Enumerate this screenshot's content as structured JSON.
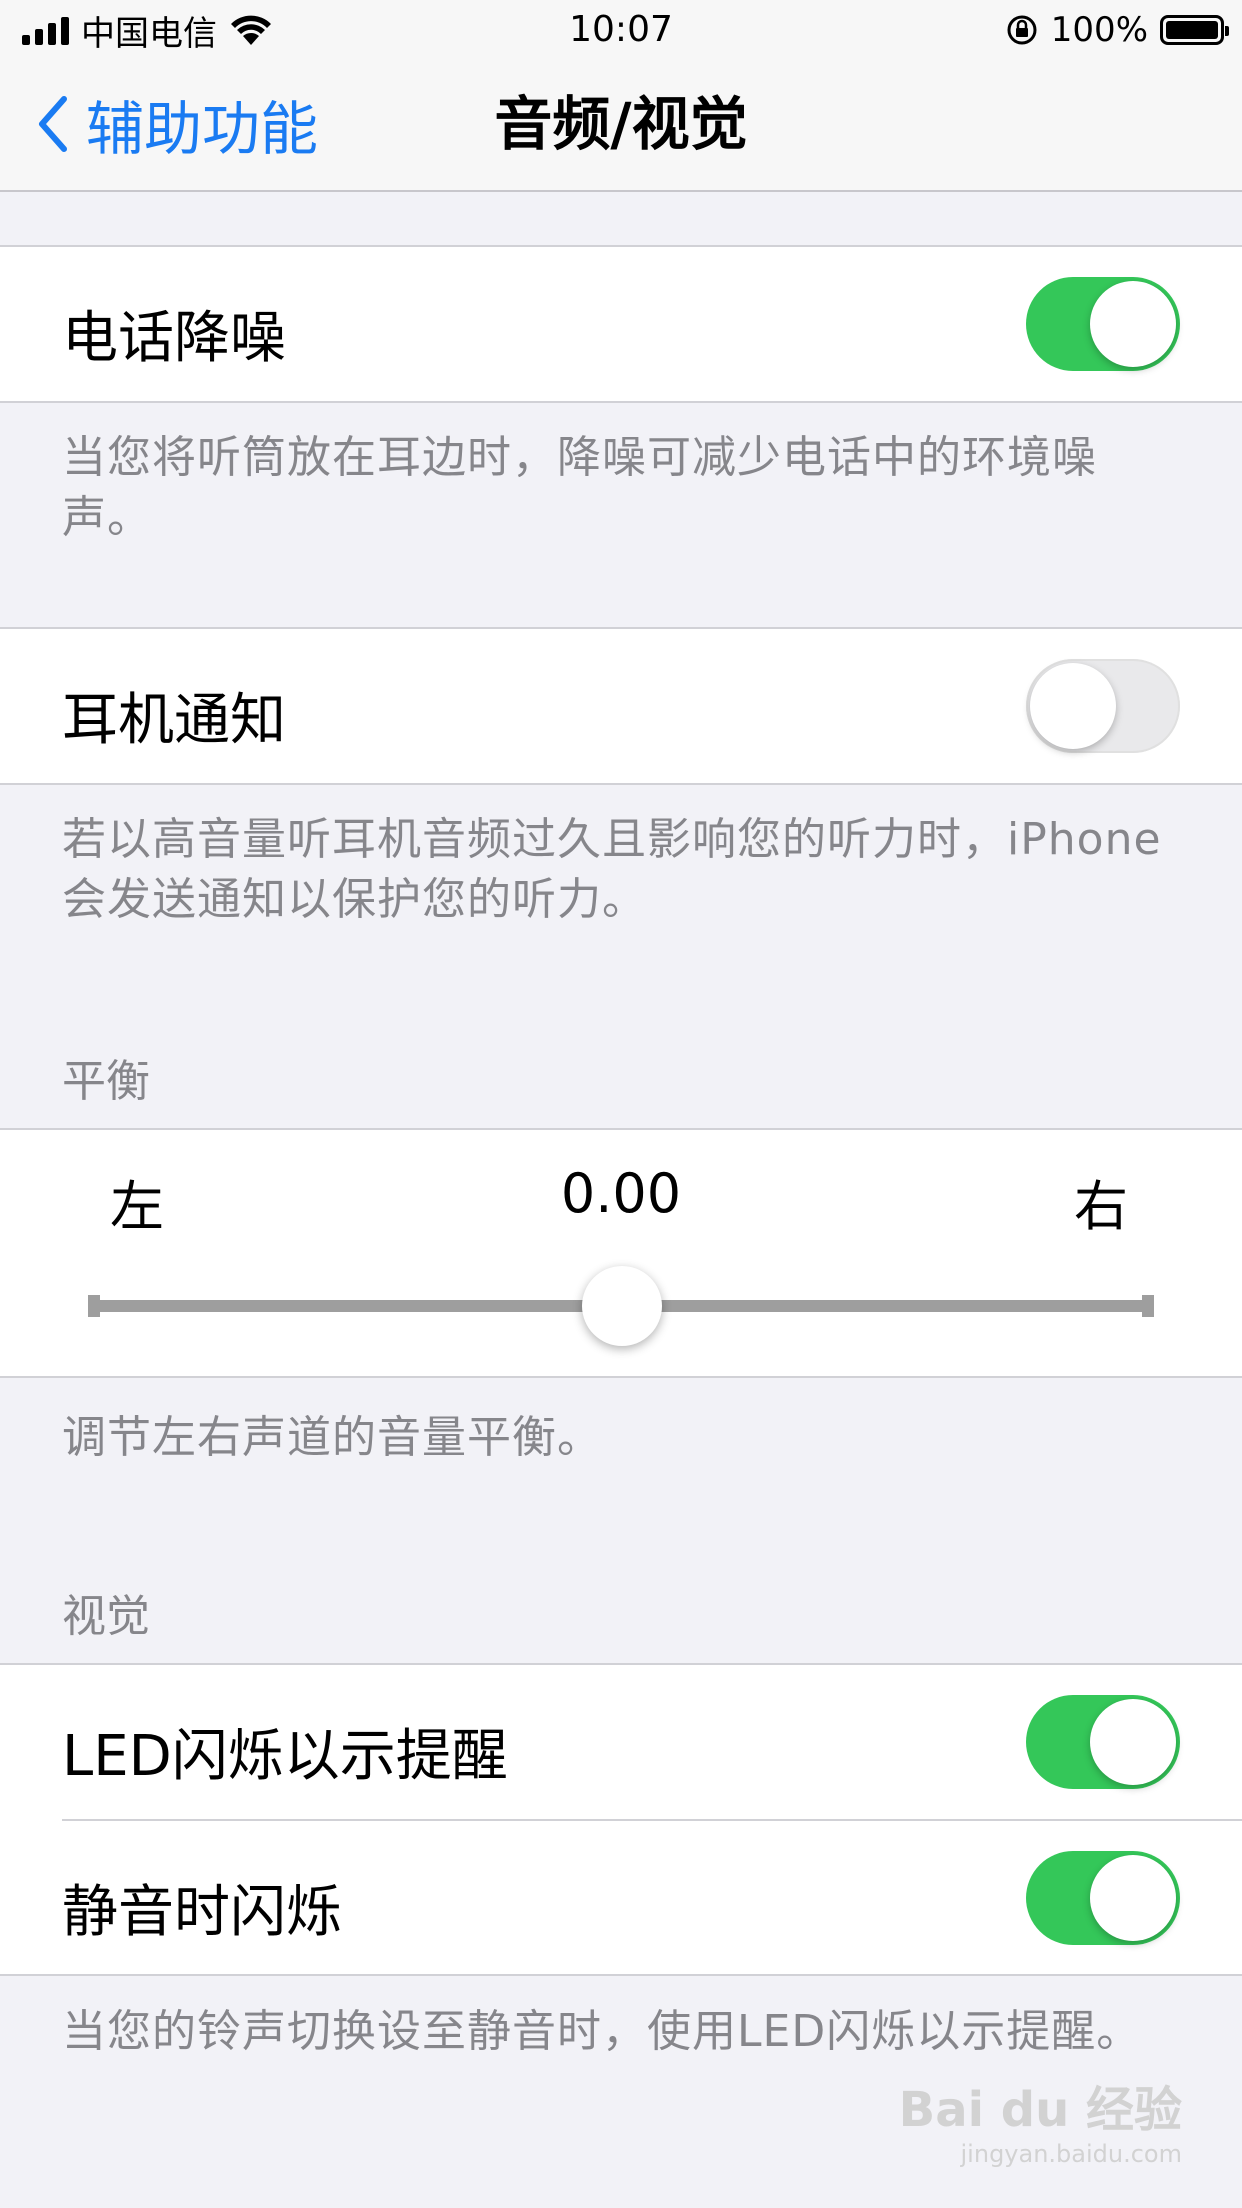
{
  "status_bar": {
    "carrier": "中国电信",
    "time": "10:07",
    "battery": "100%"
  },
  "nav": {
    "back_label": "辅助功能",
    "title": "音频/视觉"
  },
  "phone_noise": {
    "label": "电话降噪",
    "enabled": true,
    "footer": "当您将听筒放在耳边时，降噪可减少电话中的环境噪声。"
  },
  "headphone": {
    "label": "耳机通知",
    "enabled": false,
    "footer": "若以高音量听耳机音频过久且影响您的听力时，iPhone会发送通知以保护您的听力。"
  },
  "balance": {
    "header": "平衡",
    "left_label": "左",
    "right_label": "右",
    "value": "0.00",
    "position": 0.5,
    "footer": "调节左右声道的音量平衡。"
  },
  "visual": {
    "header": "视觉",
    "led_label": "LED闪烁以示提醒",
    "led_enabled": true,
    "silent_label": "静音时闪烁",
    "silent_enabled": true,
    "footer": "当您的铃声切换设至静音时，使用LED闪烁以示提醒。"
  },
  "watermark": {
    "main": "Bai du 经验",
    "sub": "jingyan.baidu.com"
  },
  "colors": {
    "accent": "#1a7bf2",
    "toggle_on": "#34c759",
    "toggle_off": "#e9e9eb"
  }
}
